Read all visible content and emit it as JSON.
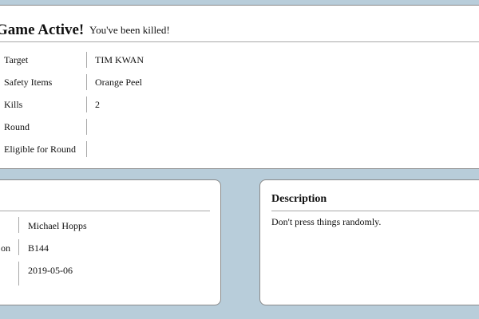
{
  "game": {
    "title": "Game Active!",
    "status_message": "You've been killed!",
    "rows": [
      {
        "label": "Target",
        "value": "TIM KWAN"
      },
      {
        "label": "Safety Items",
        "value": "Orange Peel"
      },
      {
        "label": "Kills",
        "value": "2"
      },
      {
        "label": "Round",
        "value": ""
      },
      {
        "label": "Eligible for Round",
        "value": ""
      }
    ]
  },
  "info_card": {
    "rows": [
      {
        "label": "",
        "value": "Michael Hopps"
      },
      {
        "label": "on",
        "value": "B144"
      },
      {
        "label": "",
        "value": "2019-05-06"
      }
    ]
  },
  "description": {
    "title": "Description",
    "text": "Don't press things randomly."
  }
}
